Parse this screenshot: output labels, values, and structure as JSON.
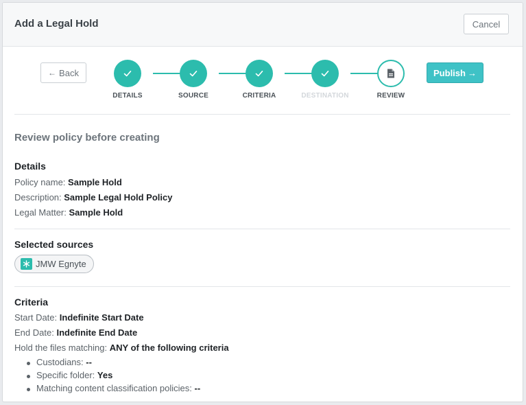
{
  "modal": {
    "title": "Add a Legal Hold",
    "cancel_label": "Cancel"
  },
  "stepper": {
    "back_label": "Back",
    "publish_label": "Publish",
    "steps": [
      {
        "label": "DETAILS",
        "state": "done"
      },
      {
        "label": "SOURCE",
        "state": "done"
      },
      {
        "label": "CRITERIA",
        "state": "done"
      },
      {
        "label": "DESTINATION",
        "state": "done-disabled"
      },
      {
        "label": "REVIEW",
        "state": "current"
      }
    ]
  },
  "review": {
    "title": "Review policy before creating",
    "details": {
      "heading": "Details",
      "rows": [
        {
          "label": "Policy name:",
          "value": "Sample Hold"
        },
        {
          "label": "Description:",
          "value": "Sample Legal Hold Policy"
        },
        {
          "label": "Legal Matter:",
          "value": "Sample Hold"
        }
      ]
    },
    "sources": {
      "heading": "Selected sources",
      "items": [
        {
          "name": "JMW Egnyte",
          "icon": "egnyte-icon"
        }
      ]
    },
    "criteria": {
      "heading": "Criteria",
      "rows": [
        {
          "label": "Start Date:",
          "value": "Indefinite Start Date"
        },
        {
          "label": "End Date:",
          "value": "Indefinite End Date"
        },
        {
          "label": "Hold the files matching:",
          "value": "ANY of the following criteria"
        }
      ],
      "bullets": [
        {
          "label": "Custodians:",
          "value": "--"
        },
        {
          "label": "Specific folder:",
          "value": "Yes"
        },
        {
          "label": "Matching content classification policies:",
          "value": "--"
        }
      ]
    }
  },
  "colors": {
    "accent": "#2cbcad",
    "publish": "#3fc2c6"
  }
}
